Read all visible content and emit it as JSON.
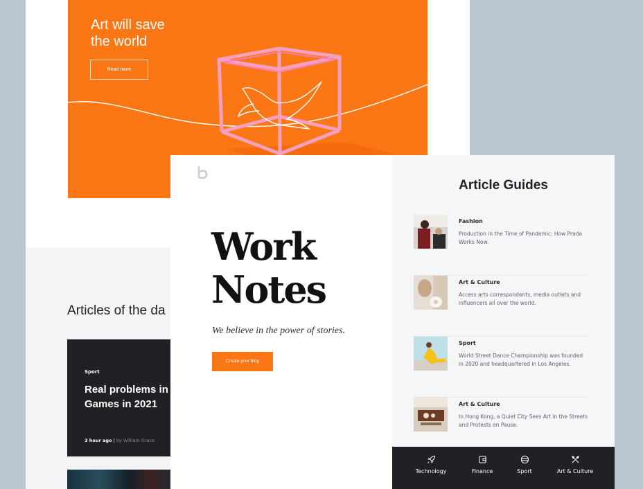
{
  "hero": {
    "title_line1": "Art will save",
    "title_line2": "the world",
    "button_label": "Read more",
    "accent_color": "#fb7614"
  },
  "articles": {
    "section_title": "Articles of the da",
    "featured": {
      "category": "Sport",
      "title_line1": "Real problems in",
      "title_line2": "Games in 2021",
      "time": "3 hour ago",
      "separator": " | ",
      "author": "by William Grace"
    }
  },
  "brand": {
    "logo_icon": "b-logo-icon",
    "title_line1": "Work",
    "title_line2": "Notes",
    "tagline": "We believe in the power of stories.",
    "cta_label": "Create your blog"
  },
  "guides": {
    "title": "Article Guides",
    "items": [
      {
        "category": "Fashion",
        "text": "Production in the Time of Pandemic: How Prada Works Now."
      },
      {
        "category": "Art & Culture",
        "text": "Access arts correspondents, media outlets and influencers all over the world."
      },
      {
        "category": "Sport",
        "text": "World Street Dance Championship was founded in 2020 and headquartered in Los Angeles."
      },
      {
        "category": "Art & Culture",
        "text": "In Hong Kong, a Quiet City Sees Art in the Streets and Protests on Pause."
      }
    ]
  },
  "nav": {
    "items": [
      {
        "label": "Technology",
        "icon": "rocket-icon"
      },
      {
        "label": "Finance",
        "icon": "wallet-icon"
      },
      {
        "label": "Sport",
        "icon": "ball-icon"
      },
      {
        "label": "Art & Culture",
        "icon": "brushes-icon"
      }
    ]
  }
}
